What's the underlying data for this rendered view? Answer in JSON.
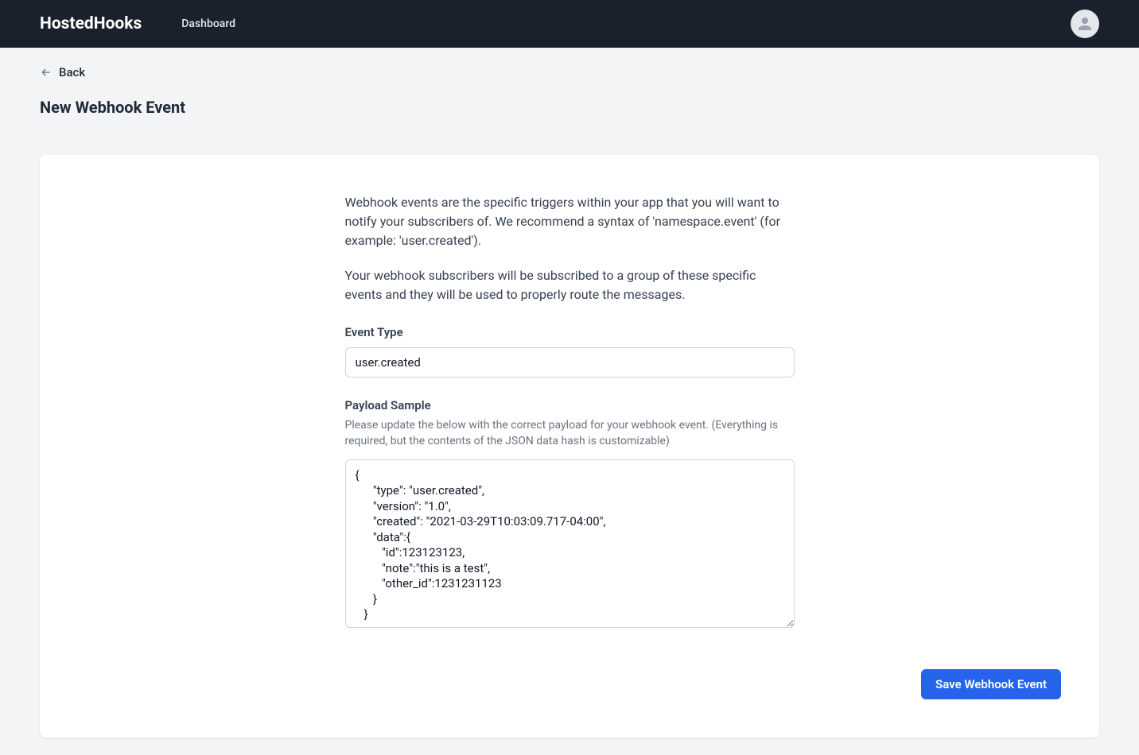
{
  "header": {
    "logo": "HostedHooks",
    "nav_dashboard": "Dashboard"
  },
  "back_label": "Back",
  "page_title": "New Webhook Event",
  "description": {
    "para1": "Webhook events are the specific triggers within your app that you will want to notify your subscribers of. We recommend a syntax of 'namespace.event' (for example: 'user.created').",
    "para2": "Your webhook subscribers will be subscribed to a group of these specific events and they will be used to properly route the messages."
  },
  "form": {
    "event_type_label": "Event Type",
    "event_type_value": "user.created",
    "payload_label": "Payload Sample",
    "payload_help": "Please update the below with the correct payload for your webhook event. (Everything is required, but the contents of the JSON data hash is customizable)",
    "payload_value": "{\n      \"type\": \"user.created\",\n      \"version\": \"1.0\",\n      \"created\": \"2021-03-29T10:03:09.717-04:00\",\n      \"data\":{\n         \"id\":123123123,\n         \"note\":\"this is a test\",\n         \"other_id\":1231231123\n      }\n   }"
  },
  "buttons": {
    "save": "Save Webhook Event"
  }
}
